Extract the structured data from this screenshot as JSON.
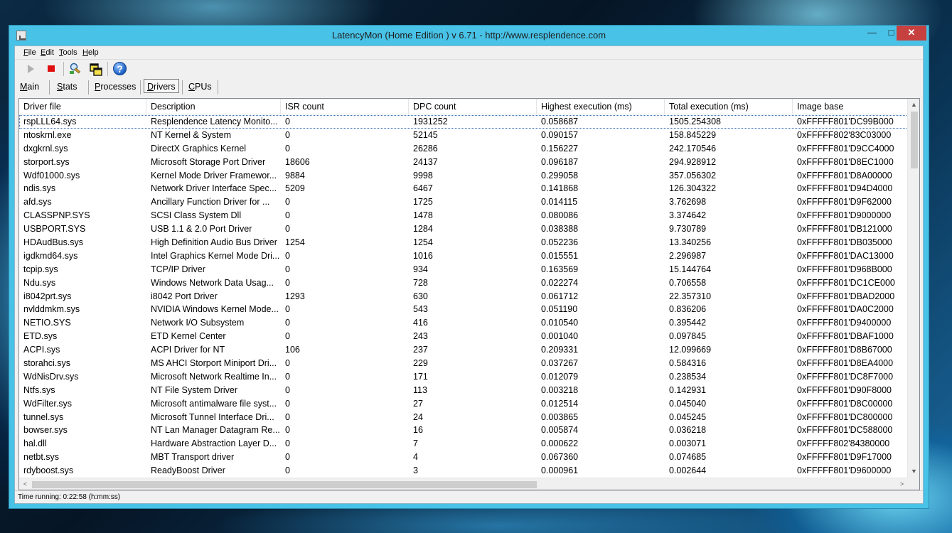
{
  "window": {
    "title": "LatencyMon  (Home Edition )  v 6.71 - http://www.resplendence.com",
    "minimize": "—",
    "maximize": "□",
    "close": "✕"
  },
  "menu": [
    {
      "ul": "F",
      "rest": "ile"
    },
    {
      "ul": "E",
      "rest": "dit"
    },
    {
      "ul": "T",
      "rest": "ools"
    },
    {
      "ul": "H",
      "rest": "elp"
    }
  ],
  "toolbar": {
    "icons": [
      "play-icon",
      "stop-icon",
      "magnifier-tool-icon",
      "windows-icon",
      "help-icon"
    ],
    "help_glyph": "?"
  },
  "tabs": [
    {
      "ul": "M",
      "rest": "ain"
    },
    {
      "ul": "S",
      "rest": "tats"
    },
    {
      "ul": "P",
      "rest": "rocesses"
    },
    {
      "ul": "D",
      "rest": "rivers",
      "active": true
    },
    {
      "ul": "C",
      "rest": "PUs"
    }
  ],
  "columns": [
    "Driver file",
    "Description",
    "ISR count",
    "DPC count",
    "Highest execution (ms)",
    "Total execution (ms)",
    "Image base"
  ],
  "rows": [
    [
      "rspLLL64.sys",
      "Resplendence Latency Monito...",
      "0",
      "1931252",
      "0.058687",
      "1505.254308",
      "0xFFFFF801'DC99B000"
    ],
    [
      "ntoskrnl.exe",
      "NT Kernel & System",
      "0",
      "52145",
      "0.090157",
      "158.845229",
      "0xFFFFF802'83C03000"
    ],
    [
      "dxgkrnl.sys",
      "DirectX Graphics Kernel",
      "0",
      "26286",
      "0.156227",
      "242.170546",
      "0xFFFFF801'D9CC4000"
    ],
    [
      "storport.sys",
      "Microsoft Storage Port Driver",
      "18606",
      "24137",
      "0.096187",
      "294.928912",
      "0xFFFFF801'D8EC1000"
    ],
    [
      "Wdf01000.sys",
      "Kernel Mode Driver Framewor...",
      "9884",
      "9998",
      "0.299058",
      "357.056302",
      "0xFFFFF801'D8A00000"
    ],
    [
      "ndis.sys",
      "Network Driver Interface Spec...",
      "5209",
      "6467",
      "0.141868",
      "126.304322",
      "0xFFFFF801'D94D4000"
    ],
    [
      "afd.sys",
      "Ancillary Function Driver for ...",
      "0",
      "1725",
      "0.014115",
      "3.762698",
      "0xFFFFF801'D9F62000"
    ],
    [
      "CLASSPNP.SYS",
      "SCSI Class System Dll",
      "0",
      "1478",
      "0.080086",
      "3.374642",
      "0xFFFFF801'D9000000"
    ],
    [
      "USBPORT.SYS",
      "USB 1.1 & 2.0 Port Driver",
      "0",
      "1284",
      "0.038388",
      "9.730789",
      "0xFFFFF801'DB121000"
    ],
    [
      "HDAudBus.sys",
      "High Definition Audio Bus Driver",
      "1254",
      "1254",
      "0.052236",
      "13.340256",
      "0xFFFFF801'DB035000"
    ],
    [
      "igdkmd64.sys",
      "Intel Graphics Kernel Mode Dri...",
      "0",
      "1016",
      "0.015551",
      "2.296987",
      "0xFFFFF801'DAC13000"
    ],
    [
      "tcpip.sys",
      "TCP/IP Driver",
      "0",
      "934",
      "0.163569",
      "15.144764",
      "0xFFFFF801'D968B000"
    ],
    [
      "Ndu.sys",
      "Windows Network Data Usag...",
      "0",
      "728",
      "0.022274",
      "0.706558",
      "0xFFFFF801'DC1CE000"
    ],
    [
      "i8042prt.sys",
      "i8042 Port Driver",
      "1293",
      "630",
      "0.061712",
      "22.357310",
      "0xFFFFF801'DBAD2000"
    ],
    [
      "nvlddmkm.sys",
      "NVIDIA Windows Kernel Mode...",
      "0",
      "543",
      "0.051190",
      "0.836206",
      "0xFFFFF801'DA0C2000"
    ],
    [
      "NETIO.SYS",
      "Network I/O Subsystem",
      "0",
      "416",
      "0.010540",
      "0.395442",
      "0xFFFFF801'D9400000"
    ],
    [
      "ETD.sys",
      "ETD Kernel Center",
      "0",
      "243",
      "0.001040",
      "0.097845",
      "0xFFFFF801'DBAF1000"
    ],
    [
      "ACPI.sys",
      "ACPI Driver for NT",
      "106",
      "237",
      "0.209331",
      "12.099669",
      "0xFFFFF801'D8B67000"
    ],
    [
      "storahci.sys",
      "MS AHCI Storport Miniport Dri...",
      "0",
      "229",
      "0.037267",
      "0.584316",
      "0xFFFFF801'D8EA4000"
    ],
    [
      "WdNisDrv.sys",
      "Microsoft Network Realtime In...",
      "0",
      "171",
      "0.012079",
      "0.238534",
      "0xFFFFF801'DC8F7000"
    ],
    [
      "Ntfs.sys",
      "NT File System Driver",
      "0",
      "113",
      "0.003218",
      "0.142931",
      "0xFFFFF801'D90F8000"
    ],
    [
      "WdFilter.sys",
      "Microsoft antimalware file syst...",
      "0",
      "27",
      "0.012514",
      "0.045040",
      "0xFFFFF801'D8C00000"
    ],
    [
      "tunnel.sys",
      "Microsoft Tunnel Interface Dri...",
      "0",
      "24",
      "0.003865",
      "0.045245",
      "0xFFFFF801'DC800000"
    ],
    [
      "bowser.sys",
      "NT Lan Manager Datagram Re...",
      "0",
      "16",
      "0.005874",
      "0.036218",
      "0xFFFFF801'DC588000"
    ],
    [
      "hal.dll",
      "Hardware Abstraction Layer D...",
      "0",
      "7",
      "0.000622",
      "0.003071",
      "0xFFFFF802'84380000"
    ],
    [
      "netbt.sys",
      "MBT Transport driver",
      "0",
      "4",
      "0.067360",
      "0.074685",
      "0xFFFFF801'D9F17000"
    ],
    [
      "rdyboost.sys",
      "ReadyBoost Driver",
      "0",
      "3",
      "0.000961",
      "0.002644",
      "0xFFFFF801'D9600000"
    ]
  ],
  "selected_row": 0,
  "scroll": {
    "up": "▲",
    "down": "▼",
    "left": "<",
    "right": ">"
  },
  "status": {
    "text": "Time running: 0:22:58  (h:mm:ss)"
  },
  "colors": {
    "window_frame": "#48c2e6",
    "close_button": "#c74040",
    "stop": "#e01010",
    "selection_outline": "#3b6fb6"
  }
}
